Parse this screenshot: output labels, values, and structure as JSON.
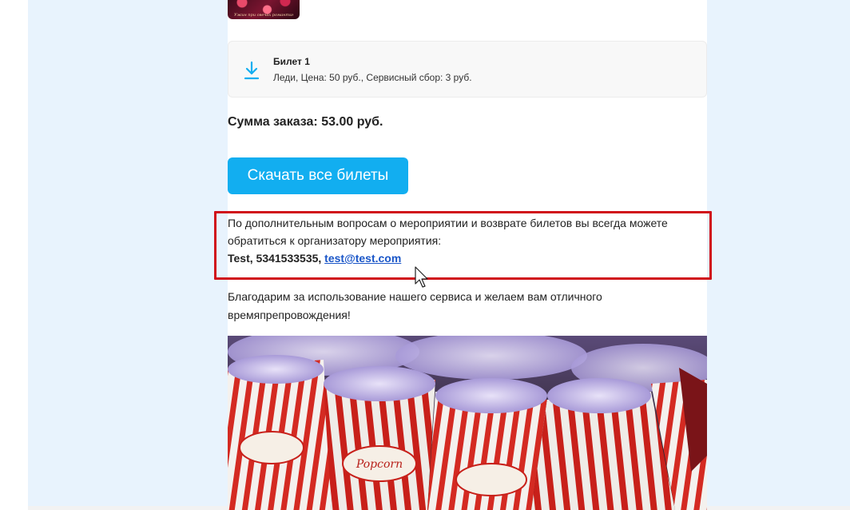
{
  "event": {
    "thumbnail_caption": "Ужин при свечах романтик · 19:30"
  },
  "ticket": {
    "title": "Билет 1",
    "description": "Леди, Цена: 50 руб., Сервисный сбор: 3 руб."
  },
  "order": {
    "sum_text": "Сумма заказа: 53.00 руб."
  },
  "actions": {
    "download_all_label": "Скачать все билеты"
  },
  "organizer": {
    "info_text": "По дополнительным вопросам о мероприятии и возврате билетов вы всегда можете обратиться к организатору мероприятия:",
    "name_phone": "Test, 5341533535, ",
    "email": "test@test.com"
  },
  "footer": {
    "thanks_text": "Благодарим за использование нашего сервиса и желаем вам отличного времяпрепровождения!"
  },
  "photo": {
    "box_label": "Popcorn"
  },
  "colors": {
    "accent": "#12aef0",
    "link": "#1a56c8",
    "highlight": "#d0101a",
    "page_bg": "#e8f3fd"
  }
}
